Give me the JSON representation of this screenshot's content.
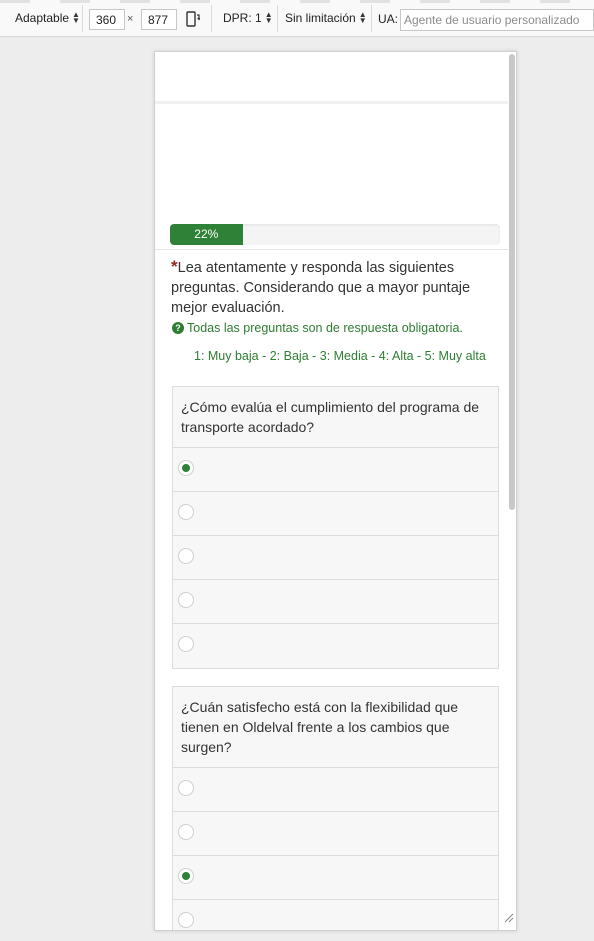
{
  "toolbar": {
    "device_label": "Adaptable",
    "width_value": "360",
    "times": "×",
    "height_value": "877",
    "dpr_label": "DPR: 1",
    "throttle_label": "Sin limitación",
    "ua_label": "UA:",
    "ua_placeholder": "Agente de usuario personalizado"
  },
  "progress": {
    "percent": 22,
    "label": "22%",
    "color": "#2e8137"
  },
  "intro": {
    "asterisk": "*",
    "text": "Lea atentamente y responda las siguientes preguntas. Considerando que a mayor puntaje mejor evaluación.",
    "mandatory_note": "Todas las preguntas son de respuesta obligatoria.",
    "scale": "1: Muy baja -  2: Baja - 3: Media - 4: Alta - 5: Muy alta"
  },
  "questions": [
    {
      "text": "¿Cómo evalúa el cumplimiento del programa de transporte acordado?",
      "selected_index": 0
    },
    {
      "text": "¿Cuán satisfecho está con la flexibilidad que tienen en Oldelval frente a los cambios que surgen?",
      "selected_index": 2
    }
  ],
  "icons": {
    "rotate": "rotate-device-icon",
    "help": "question-circle-icon",
    "resize": "resize-handle-icon"
  }
}
